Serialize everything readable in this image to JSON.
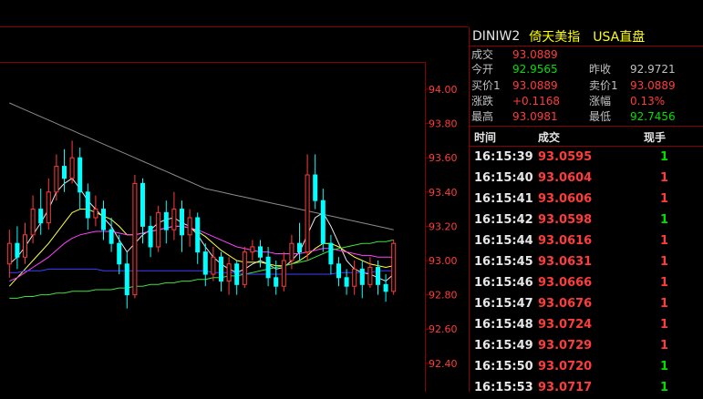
{
  "header": {
    "symbol": "DINIW2",
    "name": "倚天美指",
    "market": "USA直盘"
  },
  "stats": {
    "volume_label": "成交",
    "volume_value": "93.0889",
    "open_label": "今开",
    "open_value": "92.9565",
    "prev_close_label": "昨收",
    "prev_close_value": "92.9721",
    "bid_label": "买价1",
    "bid_value": "93.0889",
    "ask_label": "卖价1",
    "ask_value": "93.0889",
    "change_label": "涨跌",
    "change_value": "+0.1168",
    "change_pct_label": "涨幅",
    "change_pct_value": "0.13%",
    "high_label": "最高",
    "high_value": "93.0981",
    "low_label": "最低",
    "low_value": "92.7456"
  },
  "ticks_header": {
    "time": "时间",
    "price": "成交",
    "volume": "现手"
  },
  "ticks": [
    {
      "time": "16:15:39",
      "price": "93.0595",
      "volume": "1",
      "dir": "up"
    },
    {
      "time": "16:15:40",
      "price": "93.0604",
      "volume": "1",
      "dir": "down"
    },
    {
      "time": "16:15:41",
      "price": "93.0606",
      "volume": "1",
      "dir": "down"
    },
    {
      "time": "16:15:42",
      "price": "93.0598",
      "volume": "1",
      "dir": "up"
    },
    {
      "time": "16:15:44",
      "price": "93.0616",
      "volume": "1",
      "dir": "down"
    },
    {
      "time": "16:15:45",
      "price": "93.0631",
      "volume": "1",
      "dir": "down"
    },
    {
      "time": "16:15:46",
      "price": "93.0666",
      "volume": "1",
      "dir": "down"
    },
    {
      "time": "16:15:47",
      "price": "93.0676",
      "volume": "1",
      "dir": "down"
    },
    {
      "time": "16:15:48",
      "price": "93.0724",
      "volume": "1",
      "dir": "down"
    },
    {
      "time": "16:15:49",
      "price": "93.0729",
      "volume": "1",
      "dir": "down"
    },
    {
      "time": "16:15:50",
      "price": "93.0720",
      "volume": "1",
      "dir": "up"
    },
    {
      "time": "16:15:53",
      "price": "93.0717",
      "volume": "1",
      "dir": "up"
    }
  ],
  "colors": {
    "up": "#ff3c3c",
    "down": "#00ffff",
    "grid": "#8a0000",
    "axis_text": "#ff3c3c",
    "ma_white": "#e8e8e8",
    "ma_yellow": "#ffff40",
    "ma_magenta": "#ff40ff",
    "ma_green": "#40e040",
    "ma_blue": "#4040ff",
    "ma_gray": "#8c8c8c"
  },
  "chart_data": {
    "type": "candlestick",
    "yticks": [
      "94.00",
      "93.80",
      "93.60",
      "93.40",
      "93.20",
      "93.00",
      "92.80",
      "92.60",
      "92.40"
    ],
    "ylim": [
      92.3,
      94.2
    ],
    "candles": [
      {
        "o": 92.98,
        "c": 93.1,
        "h": 93.18,
        "l": 92.9
      },
      {
        "o": 93.1,
        "c": 93.02,
        "h": 93.2,
        "l": 92.95
      },
      {
        "o": 93.02,
        "c": 93.15,
        "h": 93.22,
        "l": 92.98
      },
      {
        "o": 93.15,
        "c": 93.3,
        "h": 93.38,
        "l": 93.1
      },
      {
        "o": 93.3,
        "c": 93.22,
        "h": 93.42,
        "l": 93.15
      },
      {
        "o": 93.22,
        "c": 93.4,
        "h": 93.48,
        "l": 93.18
      },
      {
        "o": 93.4,
        "c": 93.55,
        "h": 93.62,
        "l": 93.35
      },
      {
        "o": 93.55,
        "c": 93.48,
        "h": 93.65,
        "l": 93.4
      },
      {
        "o": 93.48,
        "c": 93.6,
        "h": 93.7,
        "l": 93.45
      },
      {
        "o": 93.6,
        "c": 93.4,
        "h": 93.66,
        "l": 93.3
      },
      {
        "o": 93.4,
        "c": 93.25,
        "h": 93.45,
        "l": 93.18
      },
      {
        "o": 93.25,
        "c": 93.3,
        "h": 93.38,
        "l": 93.2
      },
      {
        "o": 93.3,
        "c": 93.18,
        "h": 93.35,
        "l": 93.12
      },
      {
        "o": 93.18,
        "c": 93.1,
        "h": 93.25,
        "l": 93.05
      },
      {
        "o": 93.1,
        "c": 92.98,
        "h": 93.15,
        "l": 92.92
      },
      {
        "o": 92.98,
        "c": 92.8,
        "h": 93.05,
        "l": 92.72
      },
      {
        "o": 92.8,
        "c": 93.45,
        "h": 93.5,
        "l": 92.78
      },
      {
        "o": 93.45,
        "c": 93.2,
        "h": 93.48,
        "l": 93.1
      },
      {
        "o": 93.2,
        "c": 93.08,
        "h": 93.26,
        "l": 93.02
      },
      {
        "o": 93.08,
        "c": 93.28,
        "h": 93.32,
        "l": 93.05
      },
      {
        "o": 93.28,
        "c": 93.18,
        "h": 93.35,
        "l": 93.1
      },
      {
        "o": 93.18,
        "c": 93.3,
        "h": 93.4,
        "l": 93.12
      },
      {
        "o": 93.3,
        "c": 93.15,
        "h": 93.35,
        "l": 93.05
      },
      {
        "o": 93.15,
        "c": 93.25,
        "h": 93.3,
        "l": 93.08
      },
      {
        "o": 93.25,
        "c": 93.05,
        "h": 93.28,
        "l": 92.98
      },
      {
        "o": 93.05,
        "c": 92.92,
        "h": 93.1,
        "l": 92.85
      },
      {
        "o": 92.92,
        "c": 93.02,
        "h": 93.08,
        "l": 92.88
      },
      {
        "o": 93.02,
        "c": 92.88,
        "h": 93.05,
        "l": 92.82
      },
      {
        "o": 92.88,
        "c": 92.98,
        "h": 93.02,
        "l": 92.8
      },
      {
        "o": 92.98,
        "c": 92.86,
        "h": 93.0,
        "l": 92.8
      },
      {
        "o": 92.86,
        "c": 93.05,
        "h": 93.08,
        "l": 92.84
      },
      {
        "o": 93.05,
        "c": 93.08,
        "h": 93.12,
        "l": 93.0
      },
      {
        "o": 93.08,
        "c": 93.02,
        "h": 93.12,
        "l": 92.96
      },
      {
        "o": 93.02,
        "c": 92.9,
        "h": 93.08,
        "l": 92.85
      },
      {
        "o": 92.9,
        "c": 92.85,
        "h": 93.0,
        "l": 92.8
      },
      {
        "o": 92.85,
        "c": 93.0,
        "h": 93.05,
        "l": 92.82
      },
      {
        "o": 93.0,
        "c": 93.1,
        "h": 93.15,
        "l": 92.95
      },
      {
        "o": 93.1,
        "c": 93.05,
        "h": 93.22,
        "l": 93.0
      },
      {
        "o": 93.05,
        "c": 93.5,
        "h": 93.62,
        "l": 93.0
      },
      {
        "o": 93.5,
        "c": 93.35,
        "h": 93.62,
        "l": 93.3
      },
      {
        "o": 93.35,
        "c": 93.1,
        "h": 93.42,
        "l": 93.05
      },
      {
        "o": 93.1,
        "c": 92.98,
        "h": 93.15,
        "l": 92.92
      },
      {
        "o": 92.98,
        "c": 92.9,
        "h": 93.02,
        "l": 92.85
      },
      {
        "o": 92.9,
        "c": 92.85,
        "h": 92.95,
        "l": 92.8
      },
      {
        "o": 92.85,
        "c": 92.95,
        "h": 93.0,
        "l": 92.8
      },
      {
        "o": 92.95,
        "c": 92.86,
        "h": 93.0,
        "l": 92.78
      },
      {
        "o": 92.86,
        "c": 92.96,
        "h": 93.02,
        "l": 92.84
      },
      {
        "o": 92.96,
        "c": 92.86,
        "h": 93.0,
        "l": 92.8
      },
      {
        "o": 92.86,
        "c": 92.82,
        "h": 92.92,
        "l": 92.76
      },
      {
        "o": 92.82,
        "c": 93.1,
        "h": 93.12,
        "l": 92.8
      }
    ],
    "ma_lines": [
      {
        "color": "ma_gray",
        "values": [
          93.92,
          93.9,
          93.88,
          93.86,
          93.84,
          93.82,
          93.8,
          93.78,
          93.76,
          93.74,
          93.72,
          93.7,
          93.68,
          93.66,
          93.64,
          93.62,
          93.6,
          93.58,
          93.56,
          93.54,
          93.52,
          93.5,
          93.48,
          93.46,
          93.44,
          93.42,
          93.41,
          93.4,
          93.39,
          93.38,
          93.37,
          93.36,
          93.35,
          93.34,
          93.33,
          93.32,
          93.31,
          93.3,
          93.29,
          93.28,
          93.27,
          93.26,
          93.25,
          93.24,
          93.23,
          93.22,
          93.21,
          93.2,
          93.19,
          93.18
        ]
      },
      {
        "color": "ma_white",
        "values": [
          92.98,
          93.02,
          93.08,
          93.15,
          93.22,
          93.3,
          93.4,
          93.45,
          93.48,
          93.42,
          93.35,
          93.3,
          93.25,
          93.2,
          93.12,
          93.05,
          93.1,
          93.15,
          93.18,
          93.22,
          93.24,
          93.25,
          93.22,
          93.2,
          93.15,
          93.08,
          93.02,
          92.98,
          92.95,
          92.93,
          92.95,
          92.98,
          93.0,
          92.98,
          92.95,
          92.96,
          93.0,
          93.05,
          93.15,
          93.25,
          93.28,
          93.2,
          93.1,
          93.0,
          92.95,
          92.93,
          92.92,
          92.9,
          92.88,
          92.92
        ]
      },
      {
        "color": "ma_yellow",
        "values": [
          92.85,
          92.9,
          92.95,
          93.0,
          93.05,
          93.1,
          93.16,
          93.22,
          93.28,
          93.3,
          93.3,
          93.28,
          93.26,
          93.24,
          93.2,
          93.15,
          93.15,
          93.16,
          93.17,
          93.18,
          93.19,
          93.2,
          93.2,
          93.19,
          93.17,
          93.14,
          93.1,
          93.06,
          93.03,
          93.0,
          92.99,
          92.99,
          92.99,
          92.98,
          92.97,
          92.97,
          92.98,
          93.0,
          93.03,
          93.07,
          93.1,
          93.1,
          93.08,
          93.05,
          93.02,
          93.0,
          92.98,
          92.97,
          92.96,
          92.97
        ]
      },
      {
        "color": "ma_magenta",
        "values": [
          92.88,
          92.9,
          92.93,
          92.96,
          92.99,
          93.02,
          93.06,
          93.1,
          93.13,
          93.15,
          93.16,
          93.17,
          93.17,
          93.17,
          93.16,
          93.15,
          93.15,
          93.16,
          93.17,
          93.18,
          93.19,
          93.2,
          93.2,
          93.19,
          93.18,
          93.16,
          93.14,
          93.12,
          93.1,
          93.08,
          93.07,
          93.06,
          93.05,
          93.05,
          93.04,
          93.04,
          93.04,
          93.04,
          93.05,
          93.06,
          93.07,
          93.07,
          93.06,
          93.05,
          93.04,
          93.03,
          93.03,
          93.02,
          93.02,
          93.02
        ]
      },
      {
        "color": "ma_green",
        "values": [
          92.78,
          92.78,
          92.79,
          92.79,
          92.8,
          92.8,
          92.81,
          92.81,
          92.82,
          92.82,
          92.82,
          92.83,
          92.83,
          92.83,
          92.84,
          92.84,
          92.85,
          92.85,
          92.86,
          92.86,
          92.87,
          92.87,
          92.88,
          92.88,
          92.89,
          92.89,
          92.9,
          92.9,
          92.91,
          92.91,
          92.92,
          92.93,
          92.94,
          92.95,
          92.96,
          92.97,
          92.98,
          92.99,
          93.0,
          93.02,
          93.04,
          93.06,
          93.07,
          93.08,
          93.09,
          93.1,
          93.1,
          93.11,
          93.11,
          93.12
        ]
      },
      {
        "color": "ma_blue",
        "values": [
          92.93,
          92.93,
          92.94,
          92.94,
          92.94,
          92.95,
          92.95,
          92.95,
          92.95,
          92.95,
          92.95,
          92.95,
          92.94,
          92.94,
          92.94,
          92.94,
          92.94,
          92.94,
          92.94,
          92.94,
          92.94,
          92.94,
          92.94,
          92.94,
          92.94,
          92.94,
          92.93,
          92.93,
          92.93,
          92.93,
          92.92,
          92.92,
          92.92,
          92.92,
          92.92,
          92.92,
          92.92,
          92.92,
          92.92,
          92.92,
          92.92,
          92.92,
          92.93,
          92.93,
          92.93,
          92.93,
          92.93,
          92.94,
          92.94,
          92.94
        ]
      }
    ]
  }
}
